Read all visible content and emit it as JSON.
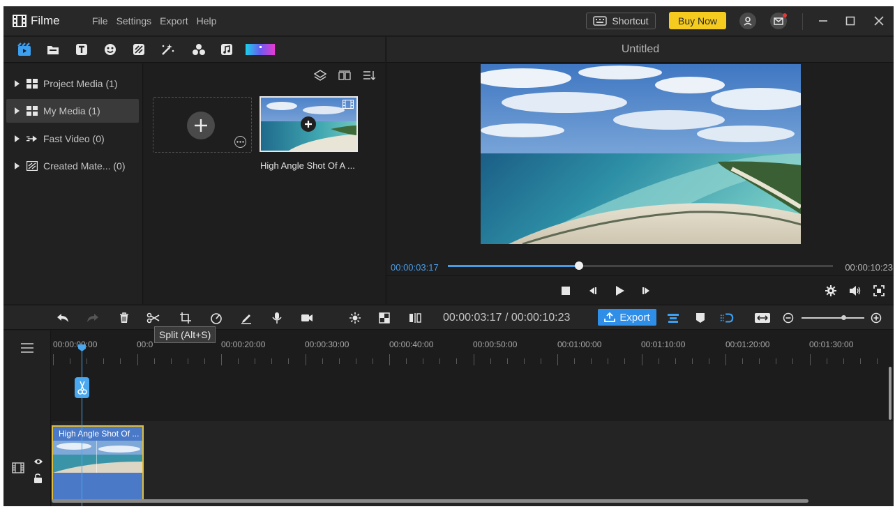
{
  "app": {
    "name": "Filme",
    "menu": [
      "File",
      "Settings",
      "Export",
      "Help"
    ],
    "shortcut_label": "Shortcut",
    "buy_label": "Buy Now"
  },
  "colors": {
    "accent": "#2f8ee8",
    "buy_button": "#f6cb1f",
    "clip_border": "#e1bd3a",
    "clip_fill": "#4a79c8",
    "playhead": "#4aa8f0"
  },
  "toolbar_icons": [
    "media-icon",
    "folder-icon",
    "text-icon",
    "sticker-icon",
    "filter-icon",
    "effects-icon",
    "elements-icon",
    "music-icon",
    "gradient-icon"
  ],
  "tree": [
    {
      "label": "Project Media (1)",
      "icon": "grid-icon",
      "active": false
    },
    {
      "label": "My Media (1)",
      "icon": "grid-icon",
      "active": true
    },
    {
      "label": "Fast Video (0)",
      "icon": "fast-video-icon",
      "active": false
    },
    {
      "label": "Created Mate... (0)",
      "icon": "created-icon",
      "active": false
    }
  ],
  "media": {
    "clip_caption": "High Angle Shot Of A ..."
  },
  "preview": {
    "title": "Untitled",
    "current_time": "00:00:03:17",
    "total_time": "00:00:10:23",
    "progress": 0.34
  },
  "timeline": {
    "time_display": "00:00:03:17 / 00:00:10:23",
    "export_label": "Export",
    "tooltip": "Split (Alt+S)",
    "ruler": [
      "00:00:00:00",
      "00:0",
      "00:00:20:00",
      "00:00:30:00",
      "00:00:40:00",
      "00:00:50:00",
      "00:01:00:00",
      "00:01:10:00",
      "00:01:20:00",
      "00:01:30:00"
    ],
    "clip_title": "High Angle Shot Of ..."
  }
}
